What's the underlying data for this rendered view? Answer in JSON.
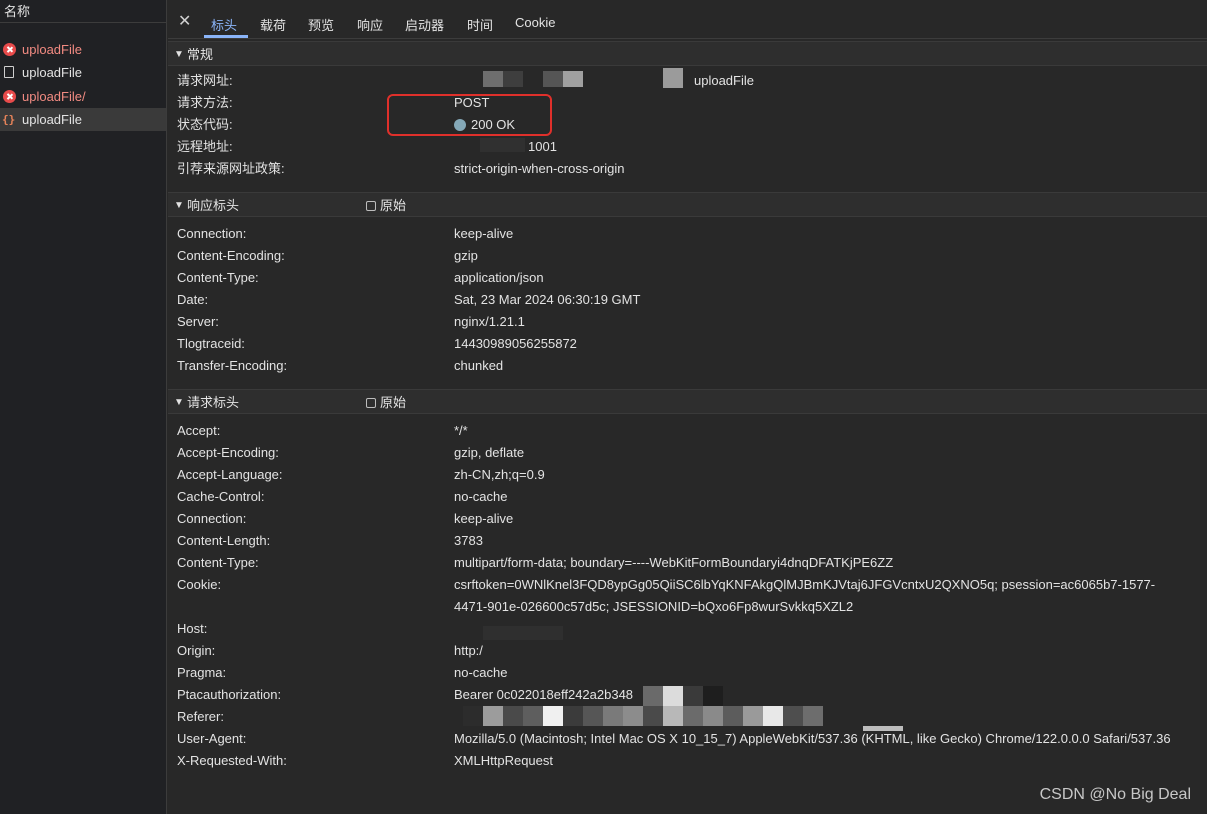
{
  "sidebar": {
    "header": "名称",
    "requests": [
      {
        "name": "uploadFile",
        "status": "error",
        "icon": "error-icon"
      },
      {
        "name": "uploadFile",
        "status": "normal",
        "icon": "document-icon"
      },
      {
        "name": "uploadFile/",
        "status": "error",
        "icon": "error-icon"
      },
      {
        "name": "uploadFile",
        "status": "selected",
        "icon": "json-icon"
      }
    ]
  },
  "tabs": {
    "close": "✕",
    "items": [
      "标头",
      "载荷",
      "预览",
      "响应",
      "启动器",
      "时间",
      "Cookie"
    ],
    "active": "标头",
    "accent": "#8ab4f8"
  },
  "general": {
    "title": "常规",
    "rows": [
      {
        "key": "请求网址:",
        "value": "uploadFile"
      },
      {
        "key": "请求方法:",
        "value": "POST"
      },
      {
        "key": "状态代码:",
        "value": "200 OK"
      },
      {
        "key": "远程地址:",
        "value": "1001"
      },
      {
        "key": "引荐来源网址政策:",
        "value": "strict-origin-when-cross-origin"
      }
    ]
  },
  "response_headers": {
    "title": "响应标头",
    "raw_label": "原始",
    "rows": [
      {
        "key": "Connection:",
        "value": "keep-alive"
      },
      {
        "key": "Content-Encoding:",
        "value": "gzip"
      },
      {
        "key": "Content-Type:",
        "value": "application/json"
      },
      {
        "key": "Date:",
        "value": "Sat, 23 Mar 2024 06:30:19 GMT"
      },
      {
        "key": "Server:",
        "value": "nginx/1.21.1"
      },
      {
        "key": "Tlogtraceid:",
        "value": "14430989056255872"
      },
      {
        "key": "Transfer-Encoding:",
        "value": "chunked"
      }
    ]
  },
  "request_headers": {
    "title": "请求标头",
    "raw_label": "原始",
    "rows": [
      {
        "key": "Accept:",
        "value": "*/*"
      },
      {
        "key": "Accept-Encoding:",
        "value": "gzip, deflate"
      },
      {
        "key": "Accept-Language:",
        "value": "zh-CN,zh;q=0.9"
      },
      {
        "key": "Cache-Control:",
        "value": "no-cache"
      },
      {
        "key": "Connection:",
        "value": "keep-alive"
      },
      {
        "key": "Content-Length:",
        "value": "3783"
      },
      {
        "key": "Content-Type:",
        "value": "multipart/form-data; boundary=----WebKitFormBoundaryi4dnqDFATKjPE6ZZ"
      },
      {
        "key": "Cookie:",
        "value": "csrftoken=0WNlKnel3FQD8ypGg05QiiSC6lbYqKNFAkgQlMJBmKJVtaj6JFGVcntxU2QXNO5q; psession=ac6065b7-1577-4471-901e-026600c57d5c; JSESSIONID=bQxo6Fp8wurSvkkq5XZL2"
      },
      {
        "key": "Host:",
        "value": ""
      },
      {
        "key": "Origin:",
        "value": "http:/"
      },
      {
        "key": "Pragma:",
        "value": "no-cache"
      },
      {
        "key": "Ptacauthorization:",
        "value": "Bearer 0c022018eff242a2b348"
      },
      {
        "key": "Referer:",
        "value": ""
      },
      {
        "key": "User-Agent:",
        "value": "Mozilla/5.0 (Macintosh; Intel Mac OS X 10_15_7) AppleWebKit/537.36 (KHTML, like Gecko) Chrome/122.0.0.0 Safari/537.36"
      },
      {
        "key": "X-Requested-With:",
        "value": "XMLHttpRequest"
      }
    ]
  },
  "watermark": "CSDN @No Big Deal",
  "colors": {
    "error": "#f28b82",
    "highlight": "#e0302b",
    "status_dot": "#85a9b8"
  }
}
